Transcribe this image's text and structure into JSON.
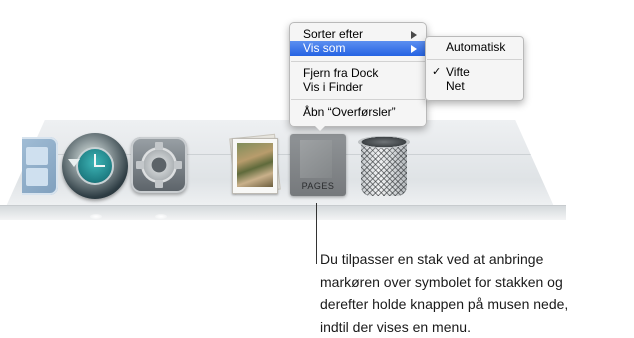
{
  "dock": {
    "stack_label": "PAGES",
    "icons": [
      "app-icon",
      "time-machine-icon",
      "system-preferences-icon",
      "photos-stack-icon",
      "downloads-stack-icon",
      "trash-icon"
    ]
  },
  "menu": {
    "items": [
      {
        "label": "Sorter efter",
        "submenu": true
      },
      {
        "label": "Vis som",
        "submenu": true,
        "highlighted": true
      },
      {
        "label": "Fjern fra Dock"
      },
      {
        "label": "Vis i Finder"
      },
      {
        "label": "Åbn “Overførsler”"
      }
    ],
    "highlight_color": "#2f6fe6"
  },
  "submenu": {
    "items": [
      {
        "label": "Automatisk",
        "checked": false
      },
      {
        "label": "Vifte",
        "checked": true
      },
      {
        "label": "Net",
        "checked": false
      }
    ],
    "check_glyph": "✓"
  },
  "callout": {
    "lines": [
      "Du tilpasser en stak ved at anbringe",
      "markøren over symbolet for stakken og",
      "derefter holde knappen på musen nede,",
      "indtil der vises en menu."
    ]
  }
}
